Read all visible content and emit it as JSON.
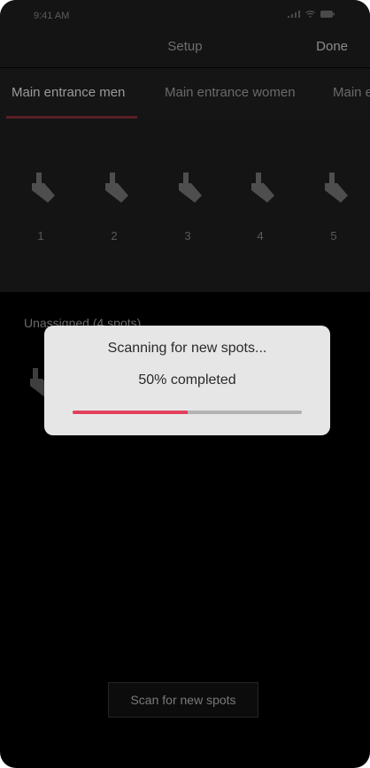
{
  "status_bar": {
    "time": "9:41 AM"
  },
  "nav": {
    "title": "Setup",
    "done_label": "Done"
  },
  "tabs": [
    {
      "label": "Main entrance men",
      "active": true
    },
    {
      "label": "Main entrance women",
      "active": false
    },
    {
      "label": "Main e",
      "active": false
    }
  ],
  "spots": [
    {
      "label": "1",
      "icon": "spotlight-icon"
    },
    {
      "label": "2",
      "icon": "spotlight-icon"
    },
    {
      "label": "3",
      "icon": "spotlight-icon"
    },
    {
      "label": "4",
      "icon": "spotlight-icon"
    },
    {
      "label": "5",
      "icon": "spotlight-icon"
    }
  ],
  "unassigned": {
    "label": "Unassigned (4 spots)"
  },
  "scan_button": {
    "label": "Scan for new spots"
  },
  "dialog": {
    "title": "Scanning for new spots...",
    "progress_text": "50% completed",
    "progress_fraction": 0.5
  },
  "colors": {
    "accent": "#e3405c",
    "background": "#000000",
    "dialog_background": "#e6e6e6"
  }
}
